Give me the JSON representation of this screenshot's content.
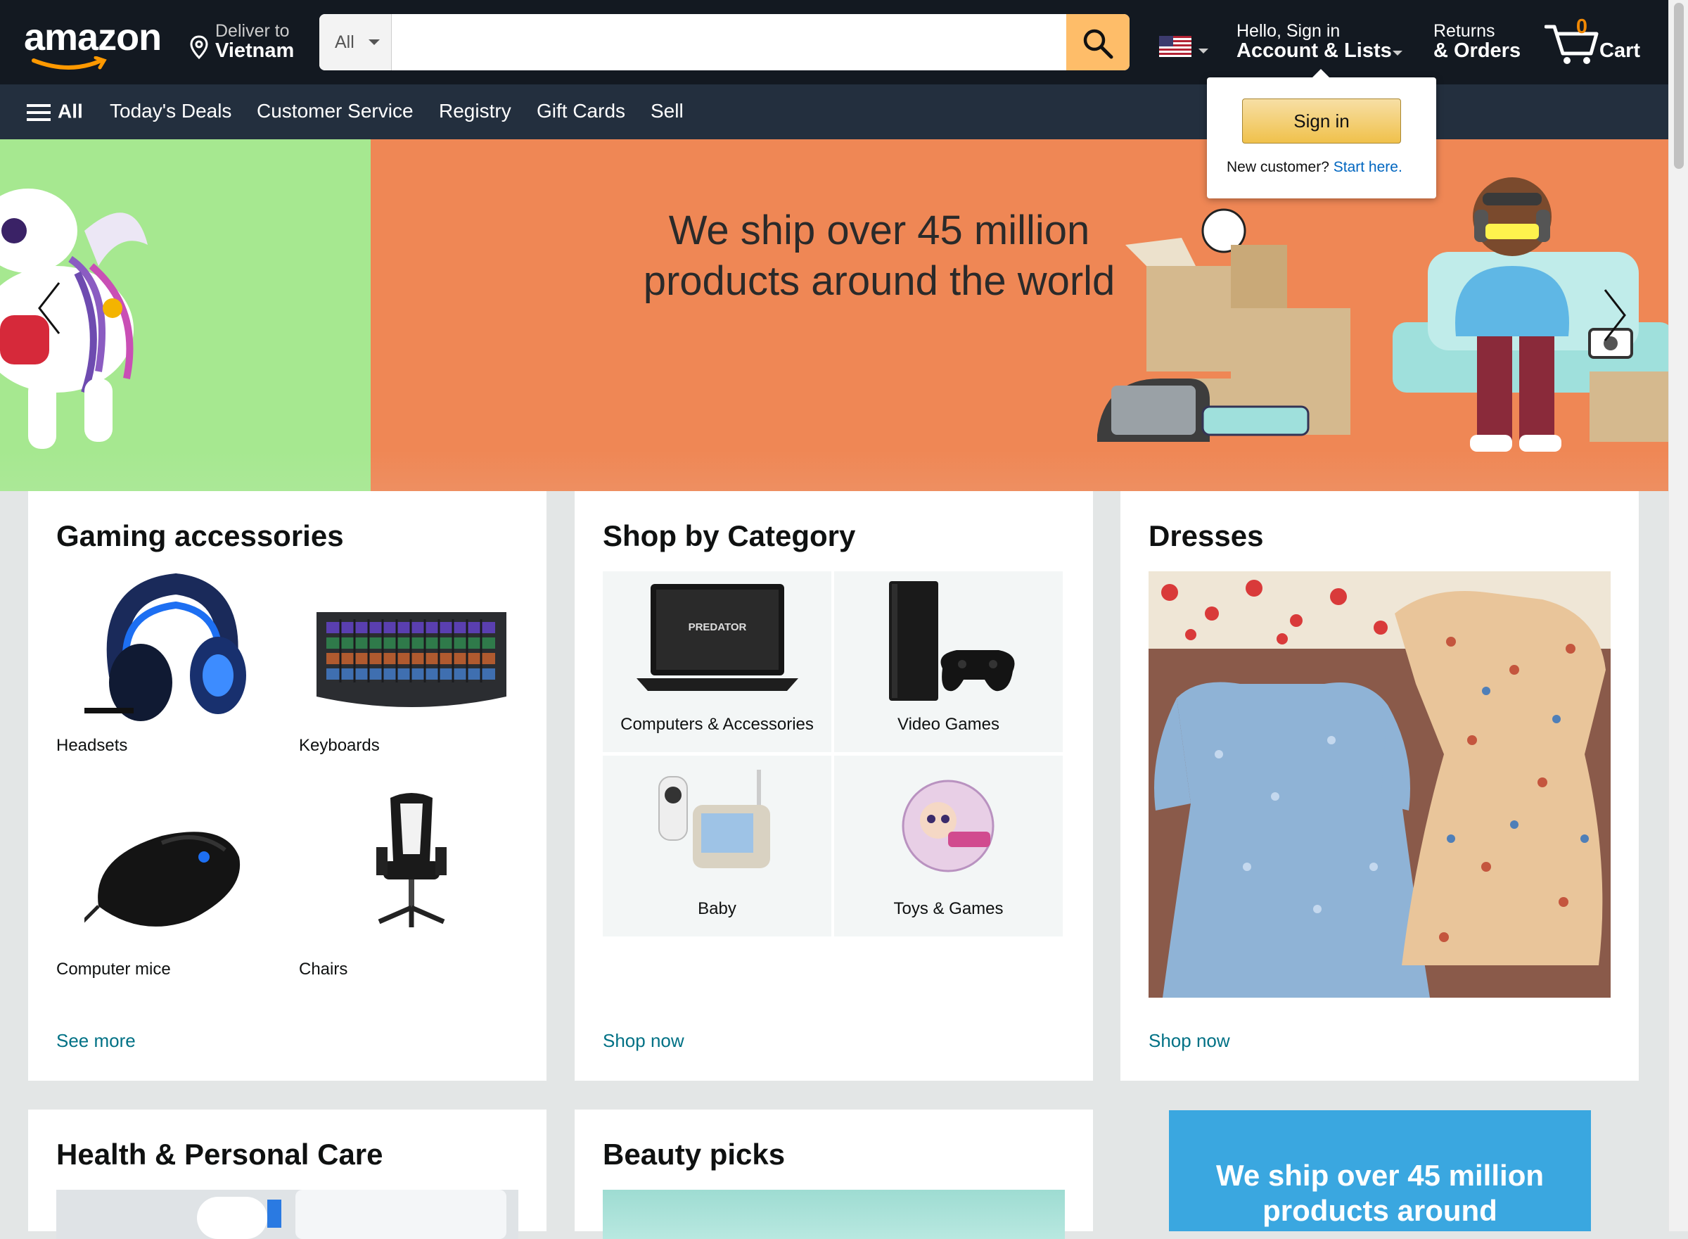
{
  "header": {
    "logo": "amazon",
    "deliver_line1": "Deliver to",
    "deliver_line2": "Vietnam",
    "search_category": "All",
    "search_placeholder": "",
    "account_line1": "Hello, Sign in",
    "account_line2": "Account & Lists",
    "returns_line1": "Returns",
    "returns_line2": "& Orders",
    "cart_count": "0",
    "cart_label": "Cart"
  },
  "subnav": {
    "all_label": "All",
    "items": [
      "Today's Deals",
      "Customer Service",
      "Registry",
      "Gift Cards",
      "Sell"
    ]
  },
  "hero": {
    "line1": "We ship over 45 million",
    "line2": "products around the world"
  },
  "flyout": {
    "signin_label": "Sign in",
    "new_customer": "New customer?",
    "start_here": "Start here."
  },
  "cards": {
    "gaming": {
      "title": "Gaming accessories",
      "items": [
        "Headsets",
        "Keyboards",
        "Computer mice",
        "Chairs"
      ],
      "link": "See more"
    },
    "category": {
      "title": "Shop by Category",
      "items": [
        "Computers & Accessories",
        "Video Games",
        "Baby",
        "Toys & Games"
      ],
      "link": "Shop now"
    },
    "dresses": {
      "title": "Dresses",
      "link": "Shop now"
    },
    "health": {
      "title": "Health & Personal Care"
    },
    "beauty": {
      "title": "Beauty picks"
    },
    "promo": {
      "line1": "We ship over 45 million",
      "line2": "products around"
    }
  },
  "colors": {
    "nav_bg": "#131921",
    "subnav_bg": "#232f3e",
    "search_button": "#febd69",
    "link": "#007185",
    "hero_bg": "#ef8755",
    "promo_bg": "#3aa7e0"
  }
}
